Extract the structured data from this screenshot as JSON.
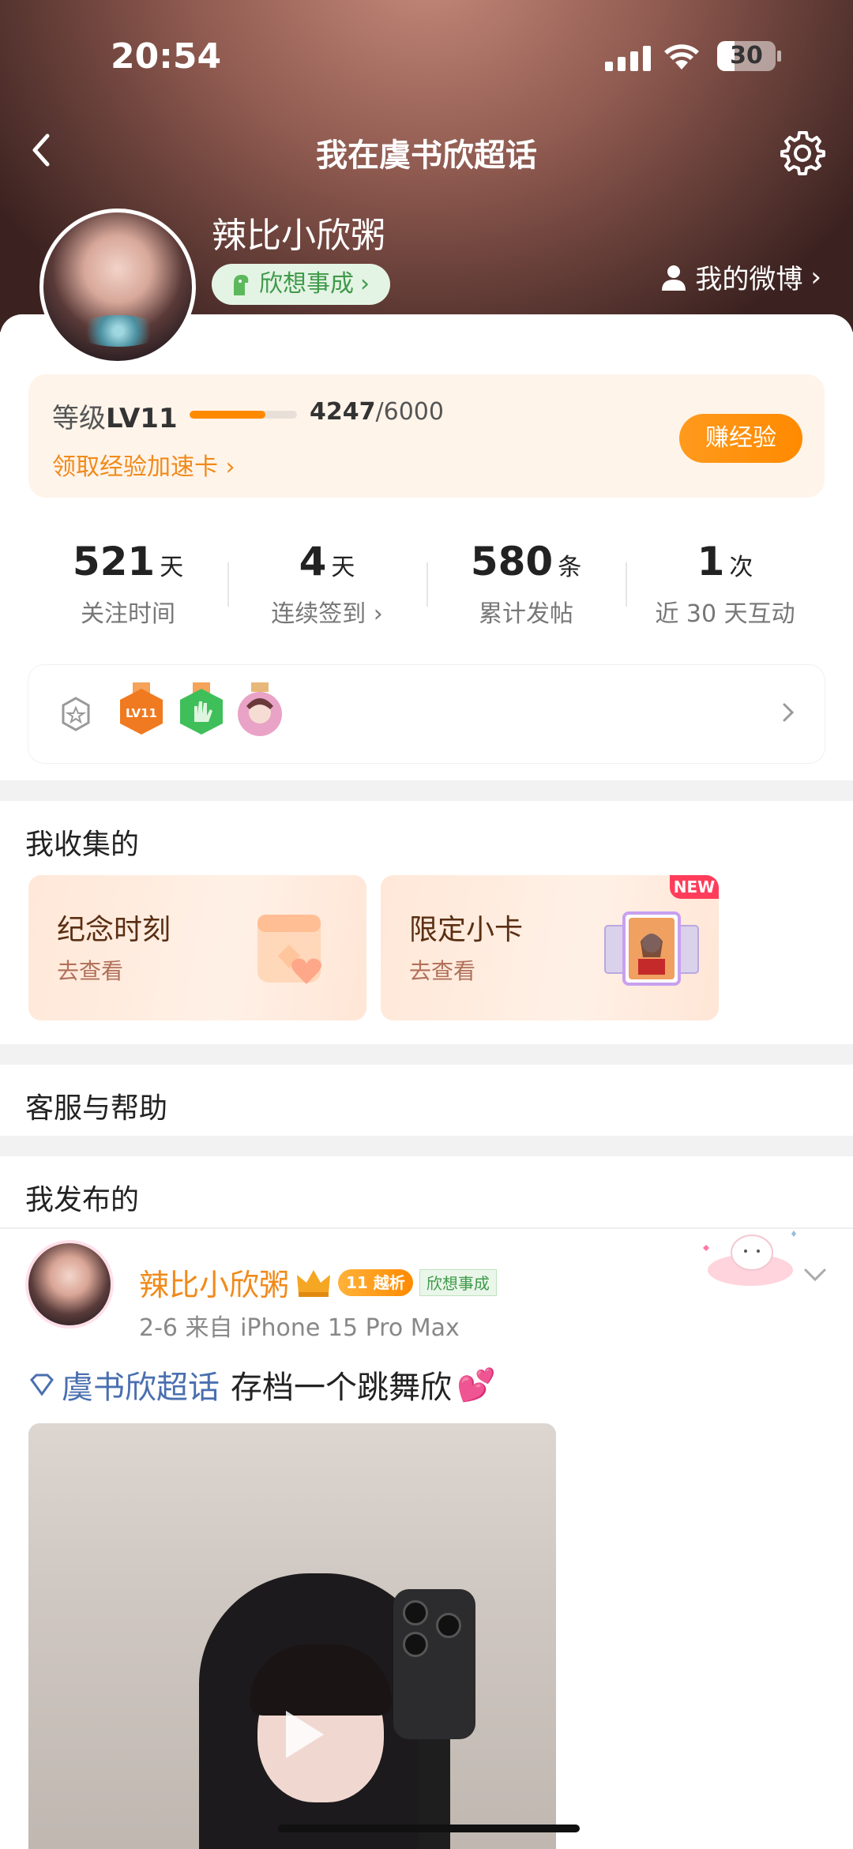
{
  "status_bar": {
    "time": "20:54",
    "battery": "30",
    "battery_level": 0.3
  },
  "nav": {
    "title": "我在虞书欣超话"
  },
  "profile": {
    "name": "辣比小欣粥",
    "fan_badge": "欣想事成",
    "my_weibo": "我的微博"
  },
  "level": {
    "label": "等级",
    "level": "LV11",
    "exp_current": "4247",
    "exp_total": "/6000",
    "progress": 0.7078,
    "speed_card": "领取经验加速卡",
    "earn_button": "赚经验"
  },
  "stats": [
    {
      "value": "521",
      "unit": "天",
      "label": "关注时间"
    },
    {
      "value": "4",
      "unit": "天",
      "label": "连续签到"
    },
    {
      "value": "580",
      "unit": "条",
      "label": "累计发帖"
    },
    {
      "value": "1",
      "unit": "次",
      "label": "近 30 天互动"
    }
  ],
  "medals": {
    "items": [
      "lv11-medal-icon",
      "hand-medal-icon",
      "portrait-medal-icon"
    ],
    "lv_text": "LV11"
  },
  "collected": {
    "title": "我收集的",
    "cards": [
      {
        "title": "纪念时刻",
        "sub": "去查看"
      },
      {
        "title": "限定小卡",
        "sub": "去查看",
        "tag": "NEW"
      }
    ]
  },
  "help": {
    "title": "客服与帮助"
  },
  "published": {
    "title": "我发布的"
  },
  "post": {
    "author": "辣比小欣粥",
    "level_tag": "越析",
    "level_num": "11",
    "fan_tag": "欣想事成",
    "meta": "2-6  来自 iPhone 15 Pro Max",
    "topic": "虞书欣超话",
    "text": "存档一个跳舞欣",
    "emoji": "💕"
  },
  "colors": {
    "accent": "#ff8a00",
    "link": "#4a6fb0",
    "green": "#3f9a4a"
  }
}
